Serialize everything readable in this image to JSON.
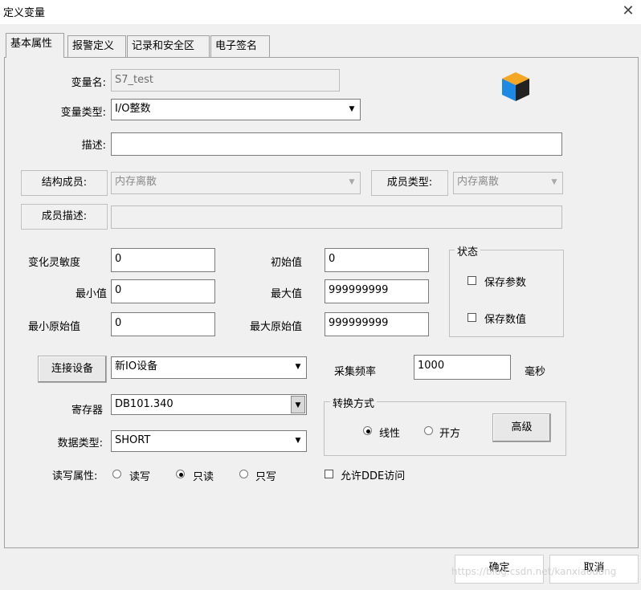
{
  "window": {
    "title": "定义变量",
    "close_glyph": "✕"
  },
  "tabs": [
    {
      "label": "基本属性",
      "active": true
    },
    {
      "label": "报警定义",
      "active": false
    },
    {
      "label": "记录和安全区",
      "active": false
    },
    {
      "label": "电子签名",
      "active": false
    }
  ],
  "basic": {
    "var_name_label": "变量名:",
    "var_name_value": "S7_test",
    "var_type_label": "变量类型:",
    "var_type_value": "I/O整数",
    "desc_label": "描述:",
    "desc_value": "",
    "struct_member_label": "结构成员:",
    "struct_member_value": "内存离散",
    "member_type_label": "成员类型:",
    "member_type_value": "内存离散",
    "member_desc_label": "成员描述:",
    "member_desc_value": ""
  },
  "values": {
    "sensitivity_label": "变化灵敏度",
    "sensitivity_value": "0",
    "initial_label": "初始值",
    "initial_value": "0",
    "min_label": "最小值",
    "min_value": "0",
    "max_label": "最大值",
    "max_value": "999999999",
    "min_raw_label": "最小原始值",
    "min_raw_value": "0",
    "max_raw_label": "最大原始值",
    "max_raw_value": "999999999"
  },
  "state": {
    "title": "状态",
    "save_param_label": "保存参数",
    "save_data_label": "保存数值"
  },
  "io": {
    "connect_button": "连接设备",
    "device_value": "新IO设备",
    "sample_label": "采集频率",
    "sample_value": "1000",
    "sample_unit": "毫秒",
    "register_label": "寄存器",
    "register_value": "DB101.340",
    "datatype_label": "数据类型:",
    "datatype_value": "SHORT",
    "rw_label": "读写属性:",
    "rw_options": [
      "读写",
      "只读",
      "只写"
    ],
    "rw_selected": "只读",
    "dde_label": "允许DDE访问"
  },
  "convert": {
    "title": "转换方式",
    "linear_label": "线性",
    "sqrt_label": "开方",
    "selected": "线性",
    "advanced_button": "高级"
  },
  "footer": {
    "ok_button": "确定",
    "cancel_button": "取消",
    "watermark": "https://blog.csdn.net/kanxiaodong"
  },
  "icon": {
    "name": "cube-icon",
    "colors": [
      "#f5a623",
      "#1e88e5",
      "#222222"
    ]
  },
  "colors": {
    "dialog_bg": "#f0f0f0",
    "field_bg": "#ffffff",
    "border": "#7a7a7a"
  }
}
